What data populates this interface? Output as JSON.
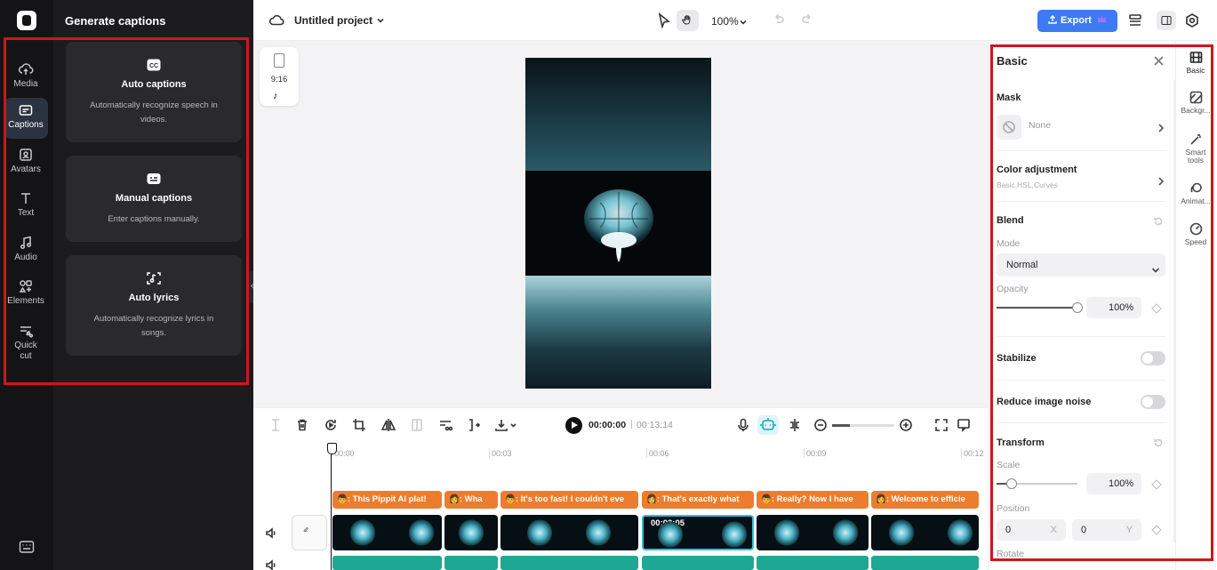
{
  "rail": {
    "items": [
      {
        "label": "Media",
        "icon": "cloud-upload-icon"
      },
      {
        "label": "Captions",
        "icon": "captions-icon"
      },
      {
        "label": "Avatars",
        "icon": "avatar-icon"
      },
      {
        "label": "Text",
        "icon": "text-icon"
      },
      {
        "label": "Audio",
        "icon": "music-note-icon"
      },
      {
        "label": "Elements",
        "icon": "elements-icon"
      },
      {
        "label": "Quick\ncut",
        "icon": "scissors-icon"
      }
    ],
    "active": "Captions"
  },
  "panel": {
    "title": "Generate captions",
    "cards": [
      {
        "title": "Auto captions",
        "desc": "Automatically recognize speech in videos.",
        "icon": "cc-icon"
      },
      {
        "title": "Manual captions",
        "desc": "Enter captions manually.",
        "icon": "keyboard-icon"
      },
      {
        "title": "Auto lyrics",
        "desc": "Automatically recognize lyrics in songs.",
        "icon": "lyrics-scan-icon"
      }
    ]
  },
  "topbar": {
    "project_title": "Untitled project",
    "zoom": "100%",
    "export_label": "Export"
  },
  "canvas": {
    "ratio": "9:16"
  },
  "player": {
    "current_time": "00:00:00",
    "separator": "|",
    "total_time": "00:13:14"
  },
  "timeline": {
    "ticks": [
      "00:00",
      "00:03",
      "00:06",
      "00:09",
      "00:12"
    ],
    "caption_clips": [
      "👦: This Pippit AI plat!",
      "👩: Wha",
      "👦: It's too fast! I couldn't eve",
      "👩: That's exactly what",
      "👦: Really? Now I have",
      "👩: Welcome to efficie"
    ],
    "selected_clip_time": "00:02:05"
  },
  "properties": {
    "title": "Basic",
    "mask_label": "Mask",
    "mask_value": "None",
    "color_label": "Color adjustment",
    "color_sub": "Basic,HSL,Curves",
    "blend_label": "Blend",
    "mode_label": "Mode",
    "mode_value": "Normal",
    "opacity_label": "Opacity",
    "opacity_value": "100%",
    "opacity_level": 1.0,
    "stabilize_label": "Stabilize",
    "stabilize_on": false,
    "noise_label": "Reduce image noise",
    "noise_on": false,
    "transform_label": "Transform",
    "scale_label": "Scale",
    "scale_value": "100%",
    "position_label": "Position",
    "pos_x": "0",
    "pos_x_axis": "X",
    "pos_y": "0",
    "pos_y_axis": "Y",
    "rotate_label": "Rotate"
  },
  "side_tabs": [
    {
      "label": "Basic",
      "icon": "basic-film-icon"
    },
    {
      "label": "Backgr...",
      "icon": "background-icon"
    },
    {
      "label": "Smart tools",
      "icon": "magic-wand-icon"
    },
    {
      "label": "Animat...",
      "icon": "animation-icon"
    },
    {
      "label": "Speed",
      "icon": "speed-icon"
    }
  ],
  "colors": {
    "accent": "#3d7bf5",
    "caption_clip": "#ed7d2d",
    "audio_clip": "#1ea893",
    "annotation": "#d2141c"
  }
}
